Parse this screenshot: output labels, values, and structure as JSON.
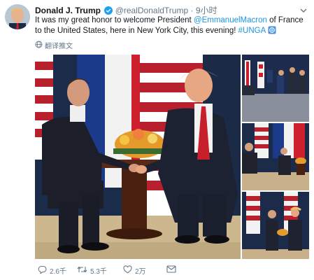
{
  "tweet": {
    "display_name": "Donald J. Trump",
    "handle": "@realDonaldTrump",
    "separator": "·",
    "time": "9小时",
    "text_before_mention": "It was my great honor to welcome President ",
    "mention": "@EmmanuelMacron",
    "text_after_mention": " of France to the United States, here in New York City, this evening! ",
    "hashtag": "#UNGA",
    "translate_label": "翻译推文"
  },
  "actions": {
    "reply_count": "2.6千",
    "retweet_count": "5.3千",
    "like_count": "2万"
  },
  "colors": {
    "link": "#1b95e0",
    "secondary_text": "#657786",
    "verified": "#1da1f2"
  },
  "icons": [
    "verified-badge-icon",
    "chevron-down-icon",
    "globe-icon",
    "unga-emoji-icon",
    "reply-icon",
    "retweet-icon",
    "like-icon",
    "message-icon"
  ]
}
